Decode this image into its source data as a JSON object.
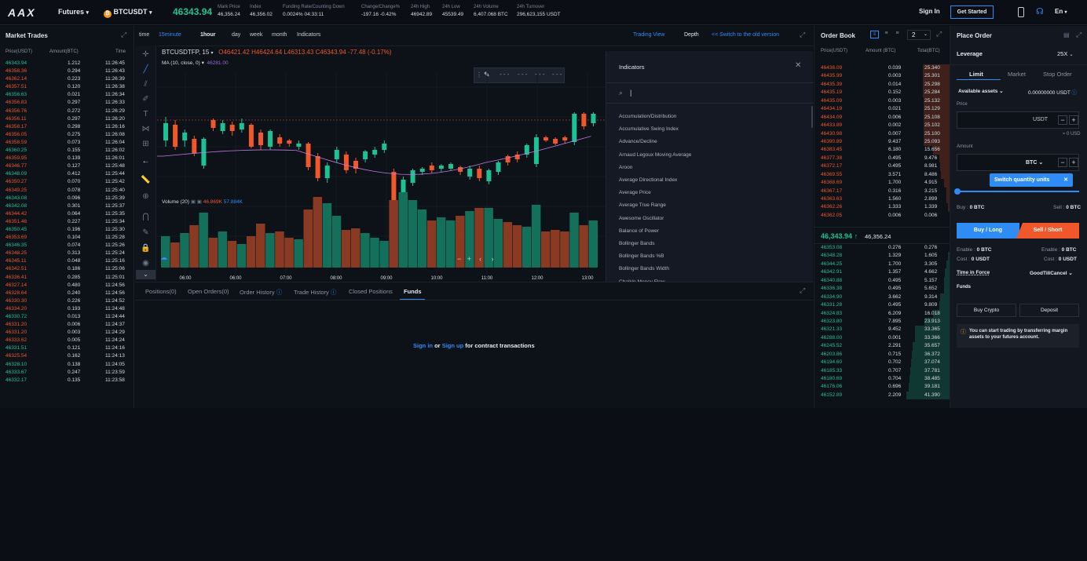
{
  "topbar": {
    "logo": "AAX",
    "futures": "Futures",
    "pair": "BTCUSDT",
    "last_price": "46343.94",
    "stats": [
      {
        "label": "Mark Price",
        "value": "46,356.24"
      },
      {
        "label": "Index",
        "value": "46,356.02"
      },
      {
        "label": "Funding Rate/Counting Down",
        "value": "0.0024%  04:33:11"
      },
      {
        "label": "Change/Change%",
        "value": "-197.16  -0.42%"
      },
      {
        "label": "24h High",
        "value": "46942.89"
      },
      {
        "label": "24h Low",
        "value": "45539.49"
      },
      {
        "label": "24h Volume",
        "value": "6,407.068 BTC"
      },
      {
        "label": "24h Turnover",
        "value": "296,623,155  USDT"
      }
    ],
    "signin": "Sign In",
    "get_started": "Get Started",
    "lang": "En"
  },
  "trades": {
    "title": "Market Trades",
    "headers": [
      "Price(USDT)",
      "Amount(BTC)",
      "Time"
    ],
    "rows": [
      [
        "46343.94",
        "1.212",
        "11:26:45",
        "g"
      ],
      [
        "46358.36",
        "0.294",
        "11:26:43",
        "r"
      ],
      [
        "46362.14",
        "0.223",
        "11:26:39",
        "r"
      ],
      [
        "46357.51",
        "0.120",
        "11:26:38",
        "r"
      ],
      [
        "46356.63",
        "0.021",
        "11:26:34",
        "g"
      ],
      [
        "46356.83",
        "0.297",
        "11:26:33",
        "r"
      ],
      [
        "46356.76",
        "0.272",
        "11:26:29",
        "r"
      ],
      [
        "46356.11",
        "0.297",
        "11:26:20",
        "r"
      ],
      [
        "46358.17",
        "0.298",
        "11:26:16",
        "r"
      ],
      [
        "46356.05",
        "0.275",
        "11:26:08",
        "r"
      ],
      [
        "46358.59",
        "0.073",
        "11:26:04",
        "r"
      ],
      [
        "46360.25",
        "0.155",
        "11:26:02",
        "g"
      ],
      [
        "46359.95",
        "0.139",
        "11:26:01",
        "r"
      ],
      [
        "46346.77",
        "0.127",
        "11:25:48",
        "r"
      ],
      [
        "46348.09",
        "0.412",
        "11:25:44",
        "g"
      ],
      [
        "46350.27",
        "0.070",
        "11:25:42",
        "r"
      ],
      [
        "46349.25",
        "0.078",
        "11:25:40",
        "r"
      ],
      [
        "46343.08",
        "0.096",
        "11:25:39",
        "g"
      ],
      [
        "46342.08",
        "0.301",
        "11:25:37",
        "g"
      ],
      [
        "46344.42",
        "0.064",
        "11:25:35",
        "r"
      ],
      [
        "46351.46",
        "0.227",
        "11:25:34",
        "r"
      ],
      [
        "46350.45",
        "0.196",
        "11:25:30",
        "g"
      ],
      [
        "46353.69",
        "0.104",
        "11:25:28",
        "r"
      ],
      [
        "46346.35",
        "0.074",
        "11:25:26",
        "g"
      ],
      [
        "46348.25",
        "0.313",
        "11:25:24",
        "r"
      ],
      [
        "46345.11",
        "0.048",
        "11:25:16",
        "r"
      ],
      [
        "46342.51",
        "0.186",
        "11:25:06",
        "r"
      ],
      [
        "46336.41",
        "0.285",
        "11:25:01",
        "r"
      ],
      [
        "46327.14",
        "0.480",
        "11:24:56",
        "r"
      ],
      [
        "46328.64",
        "0.240",
        "11:24:56",
        "r"
      ],
      [
        "46330.30",
        "0.226",
        "11:24:52",
        "r"
      ],
      [
        "46334.20",
        "0.193",
        "11:24:48",
        "r"
      ],
      [
        "46330.72",
        "0.013",
        "11:24:44",
        "g"
      ],
      [
        "46331.20",
        "0.006",
        "11:24:37",
        "r"
      ],
      [
        "46331.20",
        "0.003",
        "11:24:29",
        "r"
      ],
      [
        "46333.62",
        "0.005",
        "11:24:24",
        "r"
      ],
      [
        "46331.51",
        "0.121",
        "11:24:16",
        "g"
      ],
      [
        "46325.54",
        "0.162",
        "11:24:13",
        "r"
      ],
      [
        "46328.10",
        "0.138",
        "11:24:05",
        "g"
      ],
      [
        "46333.67",
        "0.247",
        "11:23:59",
        "g"
      ],
      [
        "46332.17",
        "0.135",
        "11:23:58",
        "g"
      ]
    ]
  },
  "chart": {
    "intervals": [
      "time",
      "15minute",
      "1hour",
      "day",
      "week",
      "month",
      "Indicators"
    ],
    "trading_view": "Trading View",
    "depth": "Depth",
    "switch_old": "<< Switch to the old version",
    "symbol": "BTCUSDTFP, 15",
    "o": "O46421.42",
    "h": "H46424.64",
    "l": "L46313.43",
    "c": "C46343.94",
    "chg": "-77.48 (-0.17%)",
    "ma": "MA (10, close, 0)",
    "ma_val": "46281.00",
    "volume": "Volume (20)",
    "vol_a": "46.869K",
    "vol_b": "57.884K",
    "times": [
      "06:00",
      "06:00",
      "07:00",
      "08:00",
      "09:00",
      "10:00",
      "11:00",
      "12:00",
      "13:00"
    ],
    "colors": {
      "up": "#1ec196",
      "down": "#f0582b"
    }
  },
  "indicators": {
    "title": "Indicators",
    "search": "|",
    "items": [
      "Accumulation/Distribution",
      "Accumulative Swing Index",
      "Advance/Decline",
      "Arnaud Legoux Moving Average",
      "Aroon",
      "Average Directional Index",
      "Average Price",
      "Average True Range",
      "Awesome Oscillator",
      "Balance of Power",
      "Bollinger Bands",
      "Bollinger Bands %B",
      "Bollinger Bands Width",
      "Chaikin Money Flow"
    ]
  },
  "bottom": {
    "tabs": [
      "Positions(0)",
      "Open Orders(0)",
      "Order History",
      "Trade History",
      "Closed Positions",
      "Funds"
    ],
    "signin": "Sign in",
    "or": "or",
    "signup": "Sign up",
    "suffix": "for contract transactions"
  },
  "book": {
    "title": "Order Book",
    "headers": [
      "Price(USDT)",
      "Amount (BTC)",
      "Total(BTC)"
    ],
    "level": "2",
    "asks": [
      [
        "46436.09",
        "0.039",
        "25.340"
      ],
      [
        "46435.99",
        "0.003",
        "25.301"
      ],
      [
        "46435.39",
        "0.014",
        "25.298"
      ],
      [
        "46435.19",
        "0.152",
        "25.284"
      ],
      [
        "46435.09",
        "0.003",
        "25.132"
      ],
      [
        "46434.19",
        "0.021",
        "25.129"
      ],
      [
        "46434.09",
        "0.006",
        "25.108"
      ],
      [
        "46433.89",
        "0.002",
        "25.102"
      ],
      [
        "46430.98",
        "0.007",
        "25.100"
      ],
      [
        "46390.89",
        "9.437",
        "25.093"
      ],
      [
        "46383.45",
        "6.180",
        "15.656"
      ],
      [
        "46377.38",
        "0.495",
        "9.476"
      ],
      [
        "46372.17",
        "0.495",
        "8.981"
      ],
      [
        "46369.55",
        "3.571",
        "8.486"
      ],
      [
        "46368.69",
        "1.700",
        "4.915"
      ],
      [
        "46367.17",
        "0.316",
        "3.215"
      ],
      [
        "46363.63",
        "1.560",
        "2.899"
      ],
      [
        "46362.26",
        "1.333",
        "1.339"
      ],
      [
        "46362.05",
        "0.006",
        "0.006"
      ]
    ],
    "mid_last": "46,343.94",
    "mid_mark": "46,356.24",
    "bids": [
      [
        "46353.08",
        "0.276",
        "0.276"
      ],
      [
        "46348.28",
        "1.329",
        "1.605"
      ],
      [
        "46344.25",
        "1.700",
        "3.305"
      ],
      [
        "46342.91",
        "1.357",
        "4.662"
      ],
      [
        "46340.88",
        "0.495",
        "5.157"
      ],
      [
        "46336.38",
        "0.495",
        "5.652"
      ],
      [
        "46334.90",
        "3.662",
        "9.314"
      ],
      [
        "46331.28",
        "0.495",
        "9.809"
      ],
      [
        "46324.83",
        "6.209",
        "16.018"
      ],
      [
        "46323.80",
        "7.895",
        "23.913"
      ],
      [
        "46321.33",
        "9.452",
        "33.365"
      ],
      [
        "46288.00",
        "0.001",
        "33.366"
      ],
      [
        "46245.52",
        "2.291",
        "35.657"
      ],
      [
        "46203.86",
        "0.715",
        "36.372"
      ],
      [
        "46194.60",
        "0.702",
        "37.074"
      ],
      [
        "46185.33",
        "0.707",
        "37.781"
      ],
      [
        "46180.69",
        "0.704",
        "38.485"
      ],
      [
        "46176.06",
        "0.696",
        "39.181"
      ],
      [
        "46152.89",
        "2.209",
        "41.390"
      ]
    ]
  },
  "order": {
    "title": "Place Order",
    "leverage_label": "Leverage",
    "leverage": "25X",
    "tabs": [
      "Limit",
      "Market",
      "Stop Order"
    ],
    "available": "Available assets",
    "avail_val": "0.00000000 USDT",
    "price_label": "Price",
    "price_unit": "USDT",
    "approx": "≈ 0 USD",
    "amount_label": "Amount",
    "amount_unit": "BTC",
    "tooltip": "Switch quantity units",
    "buy_label": "Buy :",
    "buy_val": "0 BTC",
    "sell_label": "Sell :",
    "sell_val": "0 BTC",
    "buy_btn": "Buy / Long",
    "sell_btn": "Sell / Short",
    "enable": "Enable :",
    "enable_val": "0 BTC",
    "cost": "Cost :",
    "cost_val": "0 USDT",
    "tif": "Time in Force",
    "tif_val": "GoodTillCancel",
    "funds": "Funds",
    "buy_crypto": "Buy Crypto",
    "deposit": "Deposit",
    "notice": "You can start trading by transferring margin assets to your futures account."
  }
}
